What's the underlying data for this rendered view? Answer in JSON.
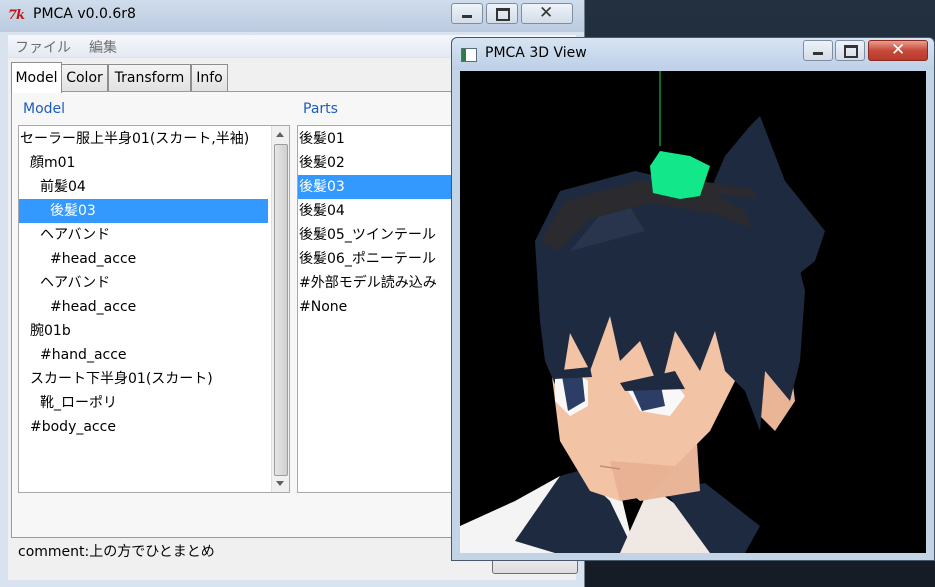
{
  "main_window": {
    "title": "PMCA v0.0.6r8",
    "logo_text": "7k",
    "menu": [
      "ファイル",
      "編集"
    ],
    "tabs": [
      "Model",
      "Color",
      "Transform",
      "Info"
    ],
    "active_tab": "Model",
    "model_panel": {
      "label": "Model",
      "items": [
        {
          "text": "セーラー服上半身01(スカート,半袖)",
          "indent": 0
        },
        {
          "text": "顔m01",
          "indent": 1
        },
        {
          "text": "前髪04",
          "indent": 2
        },
        {
          "text": "後髪03",
          "indent": 3,
          "selected": true
        },
        {
          "text": "ヘアバンド",
          "indent": 2
        },
        {
          "text": "#head_acce",
          "indent": 3
        },
        {
          "text": "ヘアバンド",
          "indent": 2
        },
        {
          "text": "#head_acce",
          "indent": 3
        },
        {
          "text": "腕01b",
          "indent": 1
        },
        {
          "text": "#hand_acce",
          "indent": 2
        },
        {
          "text": "スカート下半身01(スカート)",
          "indent": 1
        },
        {
          "text": "靴_ローポリ",
          "indent": 2
        },
        {
          "text": "#body_acce",
          "indent": 1
        }
      ]
    },
    "parts_panel": {
      "label": "Parts",
      "items": [
        {
          "text": "後髪01"
        },
        {
          "text": "後髪02"
        },
        {
          "text": "後髪03",
          "selected": true
        },
        {
          "text": "後髪04"
        },
        {
          "text": "後髪05_ツインテール"
        },
        {
          "text": "後髪06_ポニーテール"
        },
        {
          "text": "#外部モデル読み込み"
        },
        {
          "text": "#None"
        }
      ]
    },
    "comment": "comment:上の方でひとまとめ"
  },
  "view_window": {
    "title": "PMCA 3D View",
    "background": "#000000"
  },
  "colors": {
    "selection": "#3399ff",
    "group_label": "#1c5dbc",
    "hair": "#1e2a40",
    "skin": "#f2c3a4",
    "accessory": "#12e88a",
    "close_button": "#c74a3c"
  }
}
